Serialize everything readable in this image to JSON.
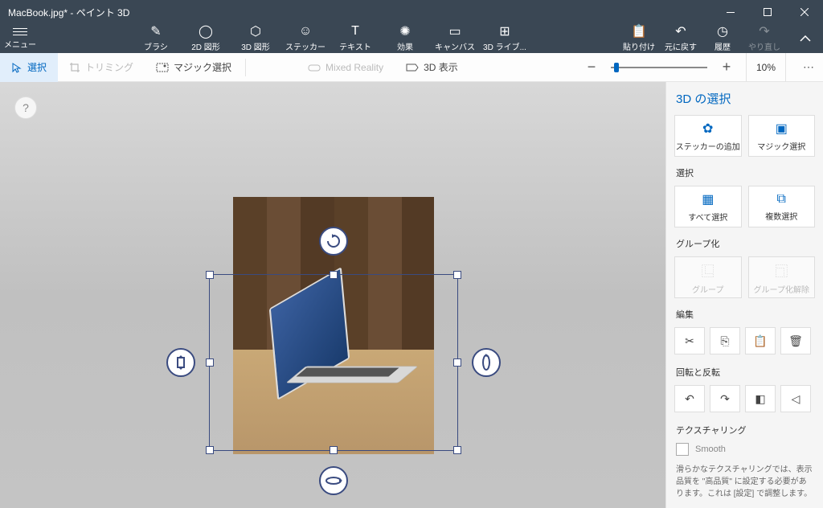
{
  "titlebar": {
    "text": "MacBook.jpg* - ペイント 3D"
  },
  "menu": {
    "label": "メニュー"
  },
  "tools": {
    "brush": "ブラシ",
    "shapes2d": "2D 図形",
    "shapes3d": "3D 図形",
    "stickers": "ステッカー",
    "text": "テキスト",
    "effects": "効果",
    "canvas": "キャンバス",
    "lib3d": "3D ライブ..."
  },
  "right_tools": {
    "paste": "貼り付け",
    "undo": "元に戻す",
    "history": "履歴",
    "redo": "やり直し"
  },
  "subbar": {
    "select": "選択",
    "trim": "トリミング",
    "magic": "マジック選択",
    "mixed": "Mixed Reality",
    "view3d": "3D 表示",
    "zoom_pct": "10%"
  },
  "panel": {
    "title": "3D の選択",
    "add_sticker": "ステッカーの追加",
    "magic_select": "マジック選択",
    "sec_select": "選択",
    "select_all": "すべて選択",
    "multi_select": "複数選択",
    "sec_group": "グループ化",
    "group": "グループ",
    "ungroup": "グループ化解除",
    "sec_edit": "編集",
    "sec_rotate": "回転と反転",
    "sec_texture": "テクスチャリング",
    "smooth": "Smooth",
    "note": "滑らかなテクスチャリングでは、表示品質を \"高品質\" に設定する必要があります。これは [設定] で調整します。"
  }
}
